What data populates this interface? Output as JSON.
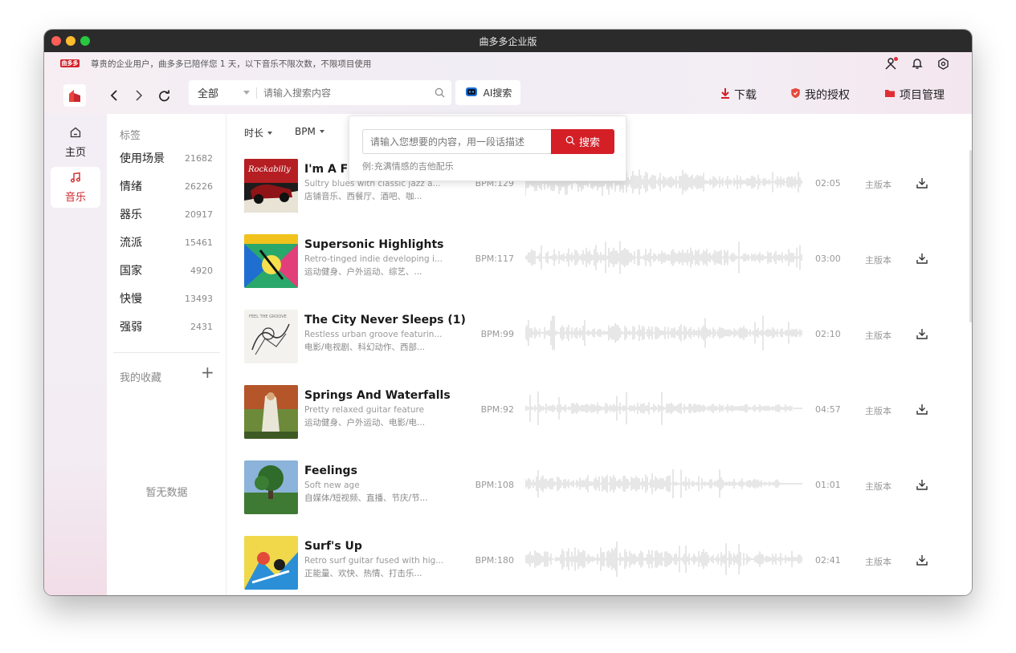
{
  "window": {
    "title": "曲多多企业版"
  },
  "notice": {
    "logo": "曲多多",
    "text": "尊贵的企业用户，曲多多已陪伴您 1 天，以下音乐不限次数，不限项目使用"
  },
  "search": {
    "scope": "全部",
    "placeholder": "请输入搜索内容"
  },
  "ai_search": {
    "label": "AI搜索",
    "placeholder": "请输入您想要的内容，用一段话描述",
    "button": "搜索",
    "example": "例:充满情感的吉他配乐"
  },
  "actions": {
    "download": "下载",
    "license": "我的授权",
    "projects": "项目管理"
  },
  "rail": {
    "home": "主页",
    "music": "音乐"
  },
  "sidebar": {
    "heading": "标签",
    "categories": [
      {
        "label": "使用场景",
        "count": "21682"
      },
      {
        "label": "情绪",
        "count": "26226"
      },
      {
        "label": "器乐",
        "count": "20917"
      },
      {
        "label": "流派",
        "count": "15461"
      },
      {
        "label": "国家",
        "count": "4920"
      },
      {
        "label": "快慢",
        "count": "13493"
      },
      {
        "label": "强弱",
        "count": "2431"
      }
    ],
    "favorites": "我的收藏",
    "favorites_add": "+",
    "empty": "暂无数据"
  },
  "filters": {
    "duration": "时长",
    "bpm": "BPM"
  },
  "colors": {
    "accent": "#d41f27",
    "wave": "#cfcfcf"
  },
  "tracks": [
    {
      "title": "I'm A Fire",
      "desc": "Sultry blues with classic jazz a...",
      "tags": "店铺音乐、西餐厅、酒吧、咖...",
      "bpm": "BPM:129",
      "duration": "02:05",
      "version": "主版本"
    },
    {
      "title": "Supersonic Highlights",
      "desc": "Retro-tinged indie developing i...",
      "tags": "运动健身、户外运动、综艺、...",
      "bpm": "BPM:117",
      "duration": "03:00",
      "version": "主版本"
    },
    {
      "title": "The City Never Sleeps (1)",
      "desc": "Restless urban groove featurin...",
      "tags": "电影/电视剧、科幻动作、西部...",
      "bpm": "BPM:99",
      "duration": "02:10",
      "version": "主版本"
    },
    {
      "title": "Springs And Waterfalls",
      "desc": "Pretty relaxed guitar feature",
      "tags": "运动健身、户外运动、电影/电...",
      "bpm": "BPM:92",
      "duration": "04:57",
      "version": "主版本"
    },
    {
      "title": "Feelings",
      "desc": "Soft new age",
      "tags": "自媒体/短视频、直播、节庆/节...",
      "bpm": "BPM:108",
      "duration": "01:01",
      "version": "主版本"
    },
    {
      "title": "Surf's Up",
      "desc": "Retro surf guitar fused with hig...",
      "tags": "正能量、欢快、热情、打击乐...",
      "bpm": "BPM:180",
      "duration": "02:41",
      "version": "主版本"
    }
  ]
}
